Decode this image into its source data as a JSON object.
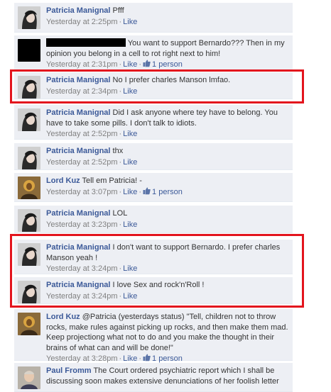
{
  "comments": [
    {
      "author": "Patricia Manignal",
      "text": "Pfff",
      "time": "Yesterday at 2:25pm",
      "like_label": "Like",
      "likes": ""
    },
    {
      "author": "",
      "text": "You want to support Bernardo??? Then in my opinion you belong in a cell to rot right next to him!",
      "time": "Yesterday at 2:31pm",
      "like_label": "Like",
      "likes": "1 person"
    },
    {
      "author": "Patricia Manignal",
      "text": "No I prefer charles Manson lmfao.",
      "time": "Yesterday at 2:34pm",
      "like_label": "Like",
      "likes": ""
    },
    {
      "author": "Patricia Manignal",
      "text": "Did I ask anyone where tey have to belong. You have to take some pills. I don't talk to idiots.",
      "time": "Yesterday at 2:52pm",
      "like_label": "Like",
      "likes": ""
    },
    {
      "author": "Patricia Manignal",
      "text": "thx",
      "time": "Yesterday at 2:52pm",
      "like_label": "Like",
      "likes": ""
    },
    {
      "author": "Lord Kuz",
      "text": "Tell em Patricia! -",
      "time": "Yesterday at 3:07pm",
      "like_label": "Like",
      "likes": "1 person"
    },
    {
      "author": "Patricia Manignal",
      "text": "LOL",
      "time": "Yesterday at 3:23pm",
      "like_label": "Like",
      "likes": ""
    },
    {
      "author": "Patricia Manignal",
      "text": "I don't want to support Bernardo. I prefer charles Manson yeah !",
      "time": "Yesterday at 3:24pm",
      "like_label": "Like",
      "likes": ""
    },
    {
      "author": "Patricia Manignal",
      "text": "I love Sex and rock'n'Roll !",
      "time": "Yesterday at 3:24pm",
      "like_label": "Like",
      "likes": ""
    },
    {
      "author": "Lord Kuz",
      "text": "@Patricia (yesterdays status) \"Tell, children not to throw rocks, make rules against picking up rocks, and then make them mad. Keep projectiong what not to do and you make the thought in their brains of what can and will be done!\"",
      "time": "Yesterday at 3:28pm",
      "like_label": "Like",
      "likes": "1 person"
    },
    {
      "author": "Paul Fromm",
      "text": "The Court ordered psychiatric report which I shall be discussing soon makes extensive denunciations of her foolish letter",
      "time": "",
      "like_label": "",
      "likes": ""
    }
  ],
  "colors": {
    "author": "#3b5998",
    "background": "#edeff4",
    "highlight_border": "#e3141d",
    "meta": "#808080"
  }
}
